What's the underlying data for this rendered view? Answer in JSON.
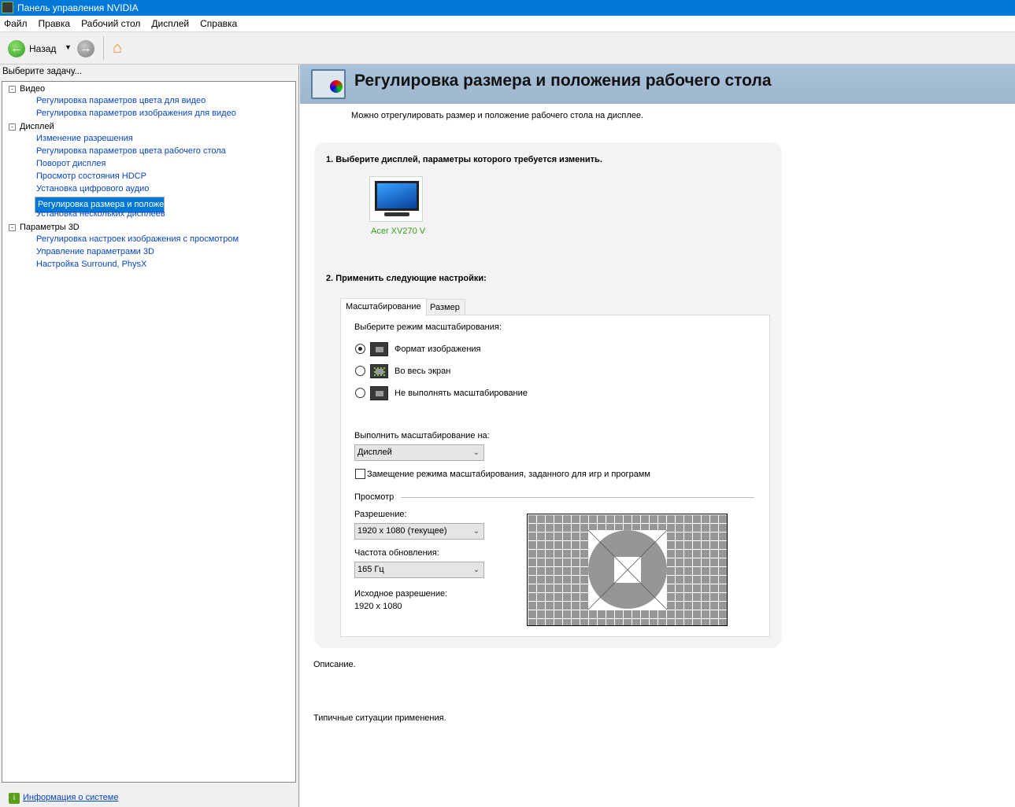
{
  "window": {
    "title": "Панель управления NVIDIA"
  },
  "menu": [
    "Файл",
    "Правка",
    "Рабочий стол",
    "Дисплей",
    "Справка"
  ],
  "toolbar": {
    "back_label": "Назад"
  },
  "sidebar": {
    "caption": "Выберите задачу...",
    "groups": [
      {
        "label": "Видео",
        "items": [
          "Регулировка параметров цвета для видео",
          "Регулировка параметров изображения для видео"
        ]
      },
      {
        "label": "Дисплей",
        "items": [
          "Изменение разрешения",
          "Регулировка параметров цвета рабочего стола",
          "Поворот дисплея",
          "Просмотр состояния HDCP",
          "Установка цифрового аудио",
          "Регулировка размера и положения рабочего стола",
          "Установка нескольких дисплеев"
        ]
      },
      {
        "label": "Параметры 3D",
        "items": [
          "Регулировка настроек изображения с просмотром",
          "Управление параметрами 3D",
          "Настройка Surround, PhysX"
        ]
      }
    ],
    "selected": "Регулировка размера и положения рабочего стола",
    "system_info_link": "Информация о системе"
  },
  "page": {
    "title": "Регулировка размера и положения рабочего стола",
    "intro": "Можно отрегулировать размер и положение рабочего стола на дисплее.",
    "step1": "1. Выберите дисплей, параметры которого требуется изменить.",
    "display_name": "Acer XV270 V",
    "step2": "2. Применить следующие настройки:",
    "tabs": [
      "Масштабирование",
      "Размер"
    ],
    "scaling_mode_label": "Выберите режим масштабирования:",
    "scaling_modes": [
      "Формат изображения",
      "Во весь экран",
      "Не выполнять масштабирование"
    ],
    "scaling_mode_selected": 0,
    "perform_on_label": "Выполнить масштабирование на:",
    "perform_on_value": "Дисплей",
    "override_label": "Замещение режима масштабирования, заданного для игр и программ",
    "override_checked": false,
    "preview_label": "Просмотр",
    "resolution_label": "Разрешение:",
    "resolution_value": "1920 x 1080 (текущее)",
    "refresh_label": "Частота обновления:",
    "refresh_value": "165 Гц",
    "native_label": "Исходное разрешение:",
    "native_value": "1920 x 1080",
    "description_label": "Описание.",
    "usage_label": "Типичные ситуации применения."
  },
  "colors": {
    "titlebar": "#0078d7",
    "link": "#0645c8",
    "display_label": "#36a01a"
  }
}
